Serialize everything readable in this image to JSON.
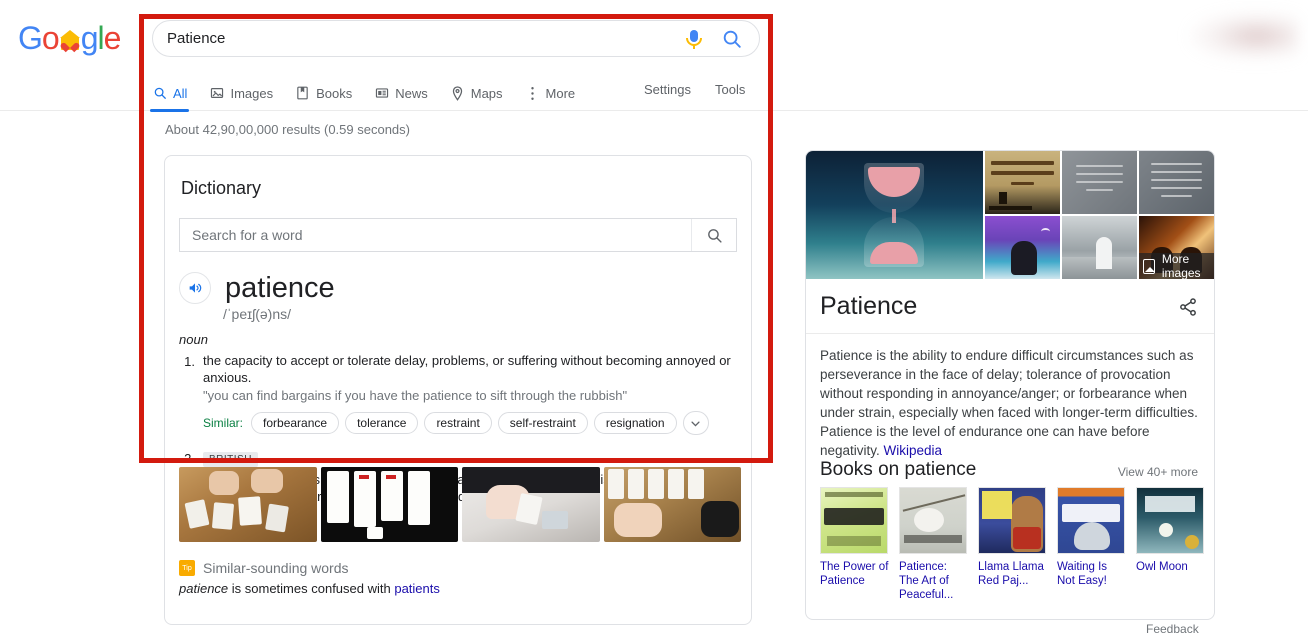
{
  "brand": {
    "name": "Google",
    "letters": [
      "G",
      "o",
      "o",
      "g",
      "l",
      "e"
    ]
  },
  "search": {
    "query": "Patience",
    "mic_icon": "microphone-icon",
    "search_icon": "search-icon"
  },
  "nav": {
    "tabs": [
      {
        "label": "All",
        "icon": "search-icon",
        "active": true
      },
      {
        "label": "Images",
        "icon": "image-icon",
        "active": false
      },
      {
        "label": "Books",
        "icon": "book-icon",
        "active": false
      },
      {
        "label": "News",
        "icon": "news-icon",
        "active": false
      },
      {
        "label": "Maps",
        "icon": "pin-icon",
        "active": false
      },
      {
        "label": "More",
        "icon": "kebab-icon",
        "active": false
      }
    ],
    "settings_label": "Settings",
    "tools_label": "Tools"
  },
  "results": {
    "stats": "About 42,90,00,000 results (0.59 seconds)"
  },
  "dictionary": {
    "card_title": "Dictionary",
    "search_placeholder": "Search for a word",
    "search_value": "",
    "speaker_icon": "speaker-icon",
    "headword": "patience",
    "phonetic": "/ˈpeɪʃ(ə)ns/",
    "part_of_speech": "noun",
    "senses": [
      {
        "number": "1.",
        "tag": "",
        "definition": "the capacity to accept or tolerate delay, problems, or suffering without becoming annoyed or anxious.",
        "example": "\"you can find bargains if you have the patience to sift through the rubbish\"",
        "similar_label": "Similar:",
        "similar": [
          "forbearance",
          "tolerance",
          "restraint",
          "self-restraint",
          "resignation"
        ],
        "expand_icon": "chevron-down-icon"
      },
      {
        "number": "2.",
        "tag": "BRITISH",
        "definition": "any of various forms of card game for one player, the object of which is to use up all one's cards by forming particular arrangements and sequences.",
        "example": "",
        "similar_label": "",
        "similar": [],
        "expand_icon": ""
      }
    ],
    "photos": [
      "card-game-photo-1",
      "card-game-photo-2",
      "card-game-photo-3",
      "card-game-photo-4"
    ],
    "similar_sounding": {
      "badge": "Tip",
      "title": "Similar-sounding words",
      "prefix_word": "patience",
      "middle_text": " is sometimes confused with ",
      "link_word": "patients"
    }
  },
  "knowledge_panel": {
    "title": "Patience",
    "share_icon": "share-icon",
    "more_images_label": "More images",
    "more_images_icon": "image-icon",
    "description": "Patience is the ability to endure difficult circumstances such as perseverance in the face of delay; tolerance of provocation without responding in annoyance/anger; or forbearance when under strain, especially when faced with longer-term difficulties. Patience is the level of endurance one can have before negativity. ",
    "source_link": "Wikipedia",
    "images": [
      "hourglass-photo",
      "quote-card-photo-1",
      "quote-card-photo-2",
      "quote-card-photo-3",
      "person-sitting-beach-photo",
      "person-on-pier-photo",
      "sunset-meditation-photo"
    ],
    "books_heading": "Books on patience",
    "books_more_label": "View 40+ more",
    "books": [
      {
        "title": "The Power of Patience"
      },
      {
        "title": "Patience: The Art of Peaceful..."
      },
      {
        "title": "Llama Llama Red Paj..."
      },
      {
        "title": "Waiting Is Not Easy!"
      },
      {
        "title": "Owl Moon"
      }
    ]
  },
  "footer": {
    "feedback_label": "Feedback"
  },
  "annotation": {
    "highlight_color": "#d31a0e"
  }
}
